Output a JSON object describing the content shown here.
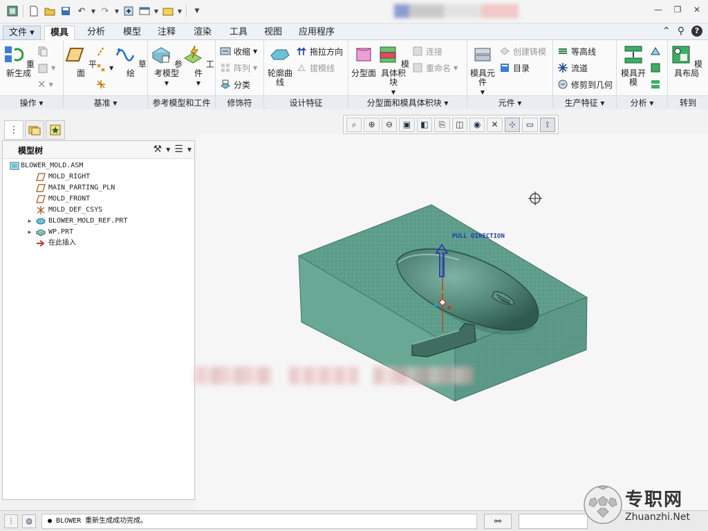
{
  "ribbon_tabs": [
    "文件",
    "模具",
    "分析",
    "模型",
    "注释",
    "渲染",
    "工具",
    "视图",
    "应用程序"
  ],
  "active_tab": "模具",
  "groups": {
    "operations": {
      "title": "操作",
      "regenerate": "重新生成"
    },
    "datum": {
      "title": "基准",
      "plane": "平面",
      "sketch": "草绘"
    },
    "refmodel": {
      "title": "参考模型和工件",
      "refmodel_btn": "参考模型",
      "workpiece": "工件"
    },
    "decoration": {
      "title": "修饰符",
      "shrink": "收缩",
      "pattern": "阵列",
      "classify": "分类"
    },
    "design": {
      "title": "设计特征",
      "silhouette": "轮廓曲线",
      "pull_dir": "拖拉方向",
      "draft": "拔模线"
    },
    "parting": {
      "title": "分型面和模具体积块",
      "parting_surface": "分型面",
      "mold_volume": "模具体积块",
      "connect": "连接",
      "rename": "重命名"
    },
    "component": {
      "title": "元件",
      "mold_component": "模具元件",
      "create_casting": "创建铸模",
      "catalog": "目录"
    },
    "production": {
      "title": "生产特征",
      "contour": "等高线",
      "runner": "流道",
      "trim": "修剪到几何"
    },
    "analysis": {
      "title": "分析",
      "mold_open": "模具开模"
    },
    "goto": {
      "title": "转到",
      "layout": "模具布局"
    }
  },
  "tree": {
    "title": "模型树",
    "items": [
      {
        "label": "BLOWER_MOLD.ASM",
        "level": 0,
        "icon": "assembly-icon",
        "expander": ""
      },
      {
        "label": "MOLD_RIGHT",
        "level": 1,
        "icon": "datum-plane-icon",
        "expander": ""
      },
      {
        "label": "MAIN_PARTING_PLN",
        "level": 1,
        "icon": "datum-plane-icon",
        "expander": ""
      },
      {
        "label": "MOLD_FRONT",
        "level": 1,
        "icon": "datum-plane-icon",
        "expander": ""
      },
      {
        "label": "MOLD_DEF_CSYS",
        "level": 1,
        "icon": "csys-icon",
        "expander": ""
      },
      {
        "label": "BLOWER_MOLD_REF.PRT",
        "level": 1,
        "icon": "part-icon",
        "expander": "▶"
      },
      {
        "label": "WP.PRT",
        "level": 1,
        "icon": "workpiece-icon",
        "expander": "▶"
      },
      {
        "label": "在此插入",
        "level": 1,
        "icon": "insert-here-icon",
        "expander": ""
      }
    ]
  },
  "viewport": {
    "pull_direction_label": "PULL DIRECTION"
  },
  "status": {
    "message": "● BLOWER 重新生成成功完成。"
  },
  "watermark": {
    "name": "专职网",
    "url_main": "Zhuanzhi",
    "url_dot": ".",
    "url_tld": "Net"
  },
  "colors": {
    "mold_block": "#5f9e8c",
    "part": "#4e7f70",
    "pull_arrow": "#1a3fb5"
  }
}
